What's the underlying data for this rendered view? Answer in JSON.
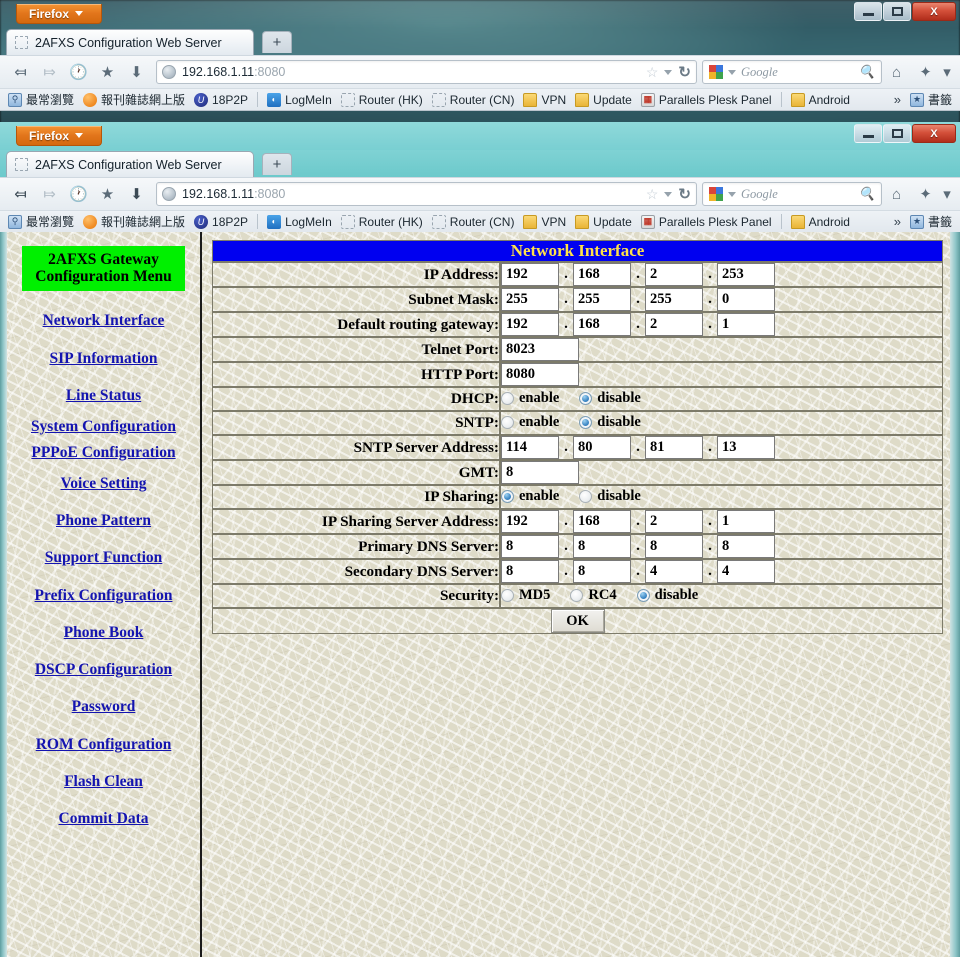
{
  "browser": {
    "app_button": "Firefox",
    "tab_title": "2AFXS Configuration Web Server",
    "new_tab_label": "+",
    "url_host": "192.168.1.11",
    "url_port": ":8080",
    "search_placeholder": "Google",
    "nav": {
      "back_icon": "back-arrow-icon",
      "forward_icon": "forward-arrow-icon",
      "history_icon": "clock-icon",
      "bookmarks_icon": "star-box-icon",
      "downloads_icon": "download-arrow-icon",
      "home_icon": "home-icon",
      "addons_icon": "addons-icon",
      "menu_icon": "chevron-down-icon"
    },
    "window_controls": {
      "minimize": "minimize-button",
      "maximize": "maximize-button",
      "close": "X"
    },
    "bookmarks": [
      {
        "label": "最常瀏覽",
        "icon": "most-visited-icon"
      },
      {
        "label": "報刊雜誌網上版",
        "icon": "orange-dot-icon"
      },
      {
        "label": "18P2P",
        "icon": "p2p-icon"
      },
      {
        "label": "LogMeIn",
        "icon": "logmein-icon"
      },
      {
        "label": "Router (HK)",
        "icon": "page-icon"
      },
      {
        "label": "Router (CN)",
        "icon": "page-icon"
      },
      {
        "label": "VPN",
        "icon": "folder-icon"
      },
      {
        "label": "Update",
        "icon": "folder-icon"
      },
      {
        "label": "Parallels Plesk Panel",
        "icon": "plesk-icon"
      },
      {
        "label": "Android",
        "icon": "folder-icon"
      }
    ],
    "bookmarks_overflow": "»",
    "bookmarks_menu_label": "書籤"
  },
  "sidebar": {
    "title_line1": "2AFXS Gateway",
    "title_line2": "Configuration Menu",
    "title_bg": "#00f000",
    "link_color": "#1414b0",
    "items": [
      {
        "label": "Network Interface",
        "lines": 1
      },
      {
        "label": "SIP Information",
        "lines": 1
      },
      {
        "label": "Line Status",
        "lines": 1
      },
      {
        "label": "System Configuration",
        "lines": 2
      },
      {
        "label": "PPPoE Configuration",
        "lines": 2
      },
      {
        "label": "Voice Setting",
        "lines": 1
      },
      {
        "label": "Phone Pattern",
        "lines": 1
      },
      {
        "label": "Support Function",
        "lines": 1
      },
      {
        "label": "Prefix Configuration",
        "lines": 1
      },
      {
        "label": "Phone Book",
        "lines": 1
      },
      {
        "label": "DSCP Configuration",
        "lines": 1
      },
      {
        "label": "Password",
        "lines": 1
      },
      {
        "label": "ROM Configuration",
        "lines": 1
      },
      {
        "label": "Flash Clean",
        "lines": 1
      },
      {
        "label": "Commit Data",
        "lines": 1
      }
    ]
  },
  "page": {
    "header": "Network Interface",
    "header_bg": "#0000f0",
    "header_fg": "#ffe24a",
    "rows": [
      {
        "label": "IP Address:",
        "type": "ipv4",
        "octets": [
          "192",
          "168",
          "2",
          "253"
        ]
      },
      {
        "label": "Subnet Mask:",
        "type": "ipv4",
        "octets": [
          "255",
          "255",
          "255",
          "0"
        ]
      },
      {
        "label": "Default routing gateway:",
        "type": "ipv4",
        "octets": [
          "192",
          "168",
          "2",
          "1"
        ]
      },
      {
        "label": "Telnet Port:",
        "type": "text",
        "value": "8023"
      },
      {
        "label": "HTTP Port:",
        "type": "text",
        "value": "8080"
      },
      {
        "label": "DHCP:",
        "type": "radio",
        "options": [
          "enable",
          "disable"
        ],
        "selected": "disable"
      },
      {
        "label": "SNTP:",
        "type": "radio",
        "options": [
          "enable",
          "disable"
        ],
        "selected": "disable"
      },
      {
        "label": "SNTP Server Address:",
        "type": "ipv4",
        "octets": [
          "114",
          "80",
          "81",
          "13"
        ]
      },
      {
        "label": "GMT:",
        "type": "text",
        "value": "8"
      },
      {
        "label": "IP Sharing:",
        "type": "radio",
        "options": [
          "enable",
          "disable"
        ],
        "selected": "enable"
      },
      {
        "label": "IP Sharing Server Address:",
        "type": "ipv4",
        "octets": [
          "192",
          "168",
          "2",
          "1"
        ]
      },
      {
        "label": "Primary DNS Server:",
        "type": "ipv4",
        "octets": [
          "8",
          "8",
          "8",
          "8"
        ]
      },
      {
        "label": "Secondary DNS Server:",
        "type": "ipv4",
        "octets": [
          "8",
          "8",
          "4",
          "4"
        ]
      },
      {
        "label": "Security:",
        "type": "radio",
        "options": [
          "MD5",
          "RC4",
          "disable"
        ],
        "selected": "disable"
      }
    ],
    "submit_label": "OK",
    "separator": "."
  }
}
